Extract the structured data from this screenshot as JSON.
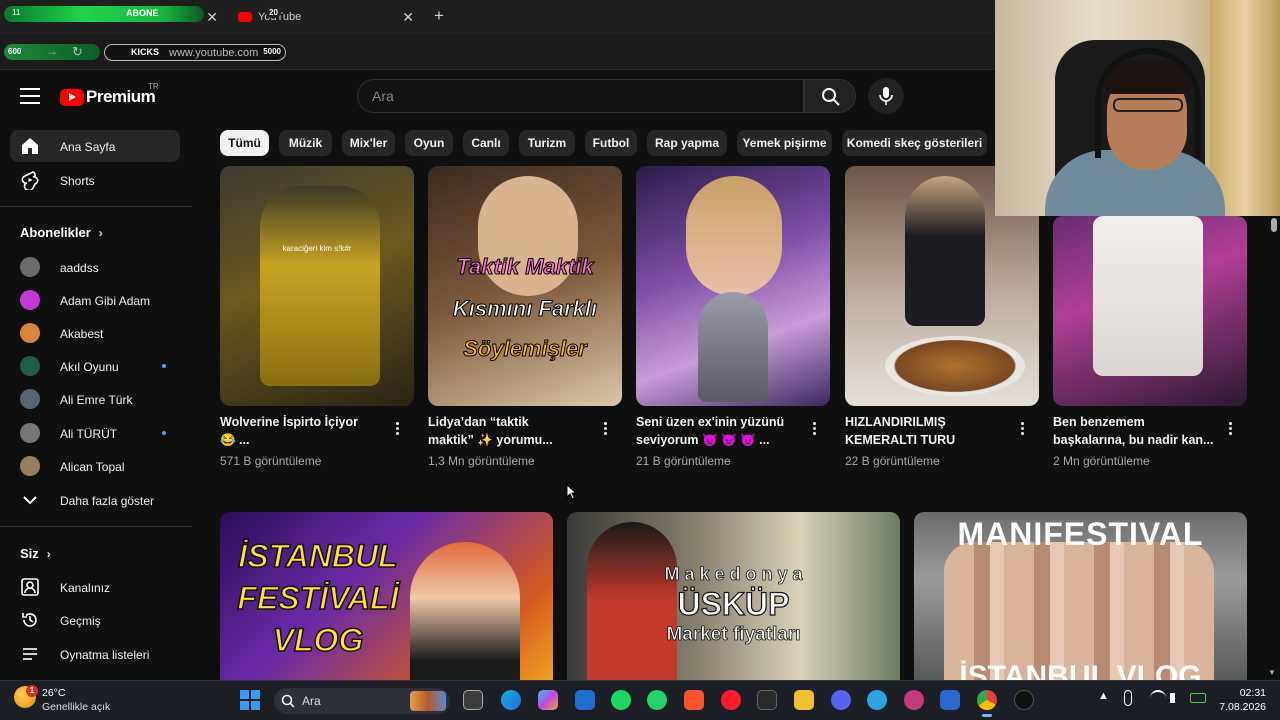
{
  "browser": {
    "tab1": {
      "count": "11",
      "overlay_label": "ABONE"
    },
    "tab2": {
      "label": "YouTube",
      "badge": "20"
    },
    "address": {
      "left_count": "600",
      "kicks_label": "KICKS",
      "url": "www.youtube.com",
      "right_count": "5000"
    }
  },
  "header": {
    "logo_text": "Premium",
    "logo_region": "TR",
    "search_placeholder": "Ara"
  },
  "sidebar": {
    "main": [
      {
        "label": "Ana Sayfa",
        "icon": "home-icon",
        "active": true
      },
      {
        "label": "Shorts",
        "icon": "shorts-icon"
      }
    ],
    "subscriptions_title": "Abonelikler",
    "subscriptions": [
      {
        "label": "aaddss",
        "color": "#6b6b6b",
        "dot": false
      },
      {
        "label": "Adam Gibi Adam",
        "color": "#c238d9",
        "dot": false
      },
      {
        "label": "Akabest",
        "color": "#d8843a",
        "dot": false
      },
      {
        "label": "Akıl Oyunu",
        "color": "#1e5e46",
        "dot": true
      },
      {
        "label": "Ali Emre Türk",
        "color": "#5a6470",
        "dot": false
      },
      {
        "label": "Ali TÜRÜT",
        "color": "#777777",
        "dot": true
      },
      {
        "label": "Alican Topal",
        "color": "#9a7b5c",
        "dot": false
      }
    ],
    "show_more": "Daha fazla göster",
    "you_title": "Siz",
    "you_items": [
      {
        "label": "Kanalınız",
        "icon": "channel-icon"
      },
      {
        "label": "Geçmiş",
        "icon": "history-icon"
      },
      {
        "label": "Oynatma listeleri",
        "icon": "playlists-icon"
      }
    ]
  },
  "chips": [
    "Tümü",
    "Müzik",
    "Mix'ler",
    "Oyun",
    "Canlı",
    "Turizm",
    "Futbol",
    "Rap yapma",
    "Yemek pişirme",
    "Komedi skeç gösterileri"
  ],
  "videos_row1": [
    {
      "title_line1": "Wolverine İspirto İçiyor",
      "title_line2": "😂 ...",
      "meta": "571 B görüntüleme",
      "overlay": "karaciğeri kim s!k#r"
    },
    {
      "title_line1": "Lidya’dan “taktik",
      "title_line2": "maktik” ✨ yorumu...",
      "meta": "1,3 Mn görüntüleme",
      "overlay1": "Taktik Maktik",
      "overlay2": "Kısmını Farklı",
      "overlay3": "Söylemişler"
    },
    {
      "title_line1": "Seni üzen ex'inin yüzünü",
      "title_line2": "seviyorum 👿 👿 👿 ...",
      "meta": "21 B görüntüleme"
    },
    {
      "title_line1": "HIZLANDIRILMIŞ",
      "title_line2": "KEMERALTI TURU",
      "meta": "22 B görüntüleme"
    },
    {
      "title_line1": "Ben benzemem",
      "title_line2": "başkalarına, bu nadir kan...",
      "meta": "2 Mn görüntüleme"
    }
  ],
  "videos_row2": [
    {
      "overlay1": "İSTANBUL",
      "overlay2": "FESTİVALİ",
      "overlay3": "VLOG"
    },
    {
      "overlay1": "M a k e d o n y a",
      "overlay2": "ÜSKÜP",
      "overlay3": "Market fiyatları"
    },
    {
      "overlay1": "MANIFESTIVAL",
      "overlay2": "İSTANBUL VLOG"
    }
  ],
  "taskbar": {
    "weather_badge": "1",
    "temperature": "26°C",
    "weather_desc": "Genellikle açık",
    "search_label": "Ara",
    "time": "02:31",
    "date": "7.08.2026"
  },
  "colors": {
    "accent": "#ff0000",
    "bg": "#0f0f0f",
    "chip": "#272727"
  }
}
